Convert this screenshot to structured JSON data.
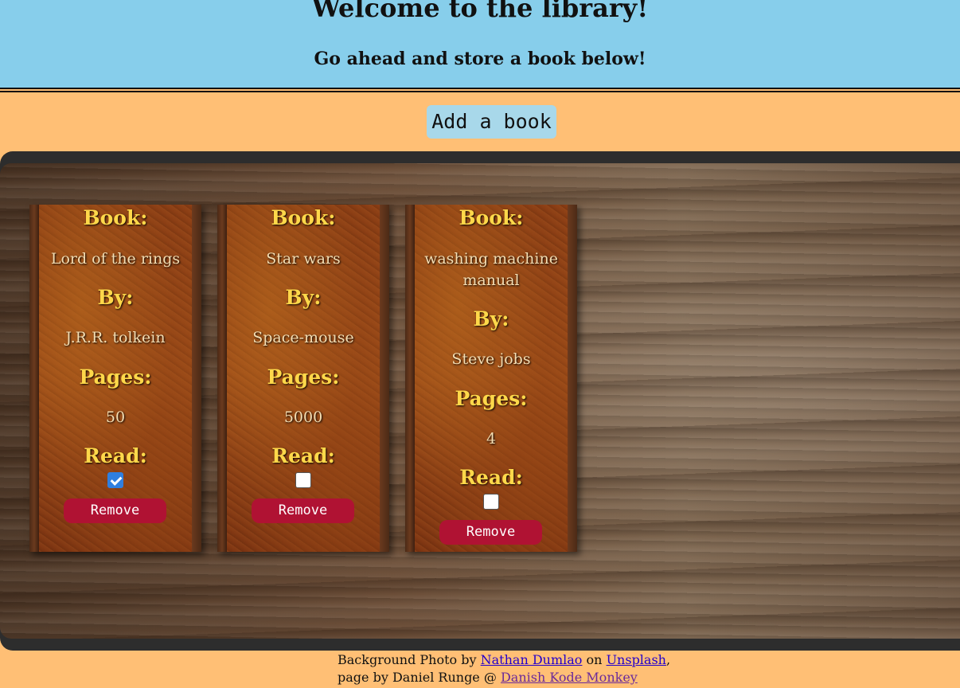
{
  "header": {
    "title": "Welcome to the library!",
    "subtitle": "Go ahead and store a book below!"
  },
  "add_button_label": "Add a book",
  "labels": {
    "book": "Book:",
    "by": "By:",
    "pages": "Pages:",
    "read": "Read:",
    "remove": "Remove"
  },
  "books": [
    {
      "title": "Lord of the rings",
      "author": "J.R.R. tolkein",
      "pages": "50",
      "read": true
    },
    {
      "title": "Star wars",
      "author": "Space-mouse",
      "pages": "5000",
      "read": false
    },
    {
      "title": "washing machine manual",
      "author": "Steve jobs",
      "pages": "4",
      "read": false
    }
  ],
  "footer": {
    "line1_prefix": "Background Photo by",
    "photographer": "Nathan Dumlao",
    "on": "on",
    "site": "Unsplash",
    "comma": ",",
    "line2_prefix": "page by Daniel Runge @",
    "author_link": "Danish Kode Monkey"
  },
  "colors": {
    "header_bg": "#87ceeb",
    "page_bg": "#ffbf75",
    "add_button_bg": "#a8d8ea",
    "remove_button_bg": "#b01233",
    "label_color": "#ffd84a",
    "checkbox_checked": "#2f7fe0"
  }
}
